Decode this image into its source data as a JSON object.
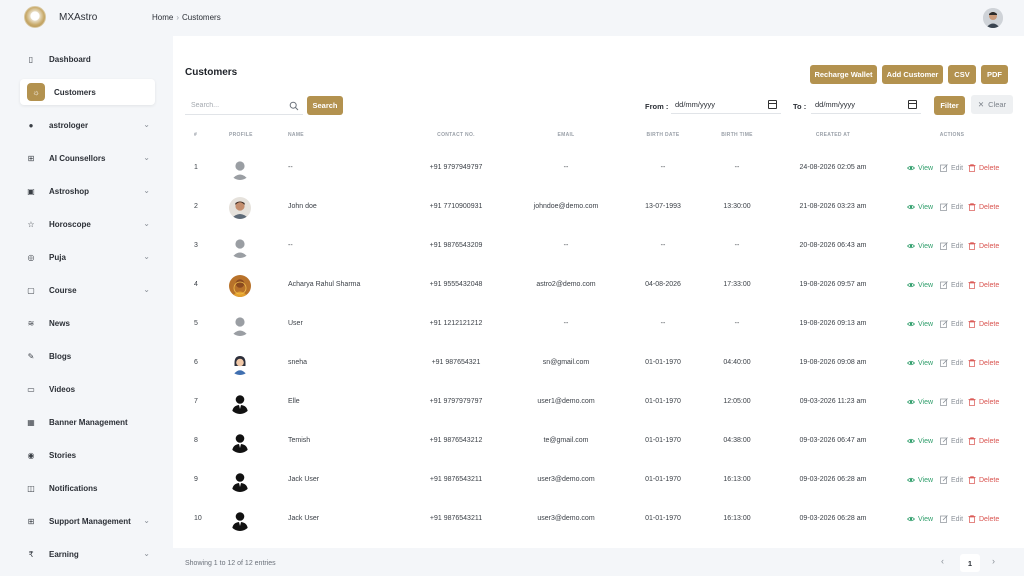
{
  "app": {
    "name": "MXAstro"
  },
  "breadcrumb": {
    "home": "Home",
    "separator": "›",
    "current": "Customers"
  },
  "sidebar": {
    "items": [
      {
        "label": "Dashboard",
        "icon": "▯",
        "chevron": false,
        "active": false
      },
      {
        "label": "Customers",
        "icon": "☼",
        "chevron": false,
        "active": true
      },
      {
        "label": "astrologer",
        "icon": "●",
        "chevron": true,
        "active": false
      },
      {
        "label": "AI Counsellors",
        "icon": "⊞",
        "chevron": true,
        "active": false
      },
      {
        "label": "Astroshop",
        "icon": "▣",
        "chevron": true,
        "active": false
      },
      {
        "label": "Horoscope",
        "icon": "☆",
        "chevron": true,
        "active": false
      },
      {
        "label": "Puja",
        "icon": "◎",
        "chevron": true,
        "active": false
      },
      {
        "label": "Course",
        "icon": "▢",
        "chevron": true,
        "active": false
      },
      {
        "label": "News",
        "icon": "≋",
        "chevron": false,
        "active": false
      },
      {
        "label": "Blogs",
        "icon": "✎",
        "chevron": false,
        "active": false
      },
      {
        "label": "Videos",
        "icon": "▭",
        "chevron": false,
        "active": false
      },
      {
        "label": "Banner Management",
        "icon": "▦",
        "chevron": false,
        "active": false
      },
      {
        "label": "Stories",
        "icon": "◉",
        "chevron": false,
        "active": false
      },
      {
        "label": "Notifications",
        "icon": "◫",
        "chevron": false,
        "active": false
      },
      {
        "label": "Support Management",
        "icon": "⊞",
        "chevron": true,
        "active": false
      },
      {
        "label": "Earning",
        "icon": "₹",
        "chevron": true,
        "active": false
      }
    ],
    "chevron_glyph": "⌄"
  },
  "page": {
    "title": "Customers"
  },
  "toolbar": {
    "recharge_wallet": "Recharge Wallet",
    "add_customer": "Add Customer",
    "csv": "CSV",
    "pdf": "PDF"
  },
  "filters": {
    "search_placeholder": "Search...",
    "search_button": "Search",
    "from_label": "From :",
    "from_value": "dd/mm/yyyy",
    "to_label": "To :",
    "to_value": "dd/mm/yyyy",
    "filter_button": "Filter",
    "clear_button": "Clear"
  },
  "table": {
    "headers": [
      "#",
      "Profile",
      "Name",
      "Contact No.",
      "Email",
      "Birth Date",
      "Birth Time",
      "Created At",
      "Actions"
    ],
    "rows": [
      {
        "num": "1",
        "avatar": "placeholder",
        "name": "--",
        "contact": "+91 9797949797",
        "email": "--",
        "birth_date": "--",
        "birth_time": "--",
        "created_at": "24-08-2026 02:05 am"
      },
      {
        "num": "2",
        "avatar": "photo-man",
        "name": "John doe",
        "contact": "+91 7710900931",
        "email": "johndoe@demo.com",
        "birth_date": "13-07-1993",
        "birth_time": "13:30:00",
        "created_at": "21-08-2026 03:23 am"
      },
      {
        "num": "3",
        "avatar": "placeholder",
        "name": "--",
        "contact": "+91 9876543209",
        "email": "--",
        "birth_date": "--",
        "birth_time": "--",
        "created_at": "20-08-2026 06:43 am"
      },
      {
        "num": "4",
        "avatar": "photo-astro",
        "name": "Acharya Rahul Sharma",
        "contact": "+91 9555432048",
        "email": "astro2@demo.com",
        "birth_date": "04-08-2026",
        "birth_time": "17:33:00",
        "created_at": "19-08-2026 09:57 am"
      },
      {
        "num": "5",
        "avatar": "placeholder",
        "name": "User",
        "contact": "+91 1212121212",
        "email": "--",
        "birth_date": "--",
        "birth_time": "--",
        "created_at": "19-08-2026 09:13 am"
      },
      {
        "num": "6",
        "avatar": "cartoon-woman",
        "name": "sneha",
        "contact": "+91 987654321",
        "email": "sn@gmail.com",
        "birth_date": "01-01-1970",
        "birth_time": "04:40:00",
        "created_at": "19-08-2026 09:08 am"
      },
      {
        "num": "7",
        "avatar": "silhouette",
        "name": "Elle",
        "contact": "+91 9797979797",
        "email": "user1@demo.com",
        "birth_date": "01-01-1970",
        "birth_time": "12:05:00",
        "created_at": "09-03-2026 11:23 am"
      },
      {
        "num": "8",
        "avatar": "silhouette",
        "name": "Temish",
        "contact": "+91 9876543212",
        "email": "te@gmail.com",
        "birth_date": "01-01-1970",
        "birth_time": "04:38:00",
        "created_at": "09-03-2026 06:47 am"
      },
      {
        "num": "9",
        "avatar": "silhouette",
        "name": "Jack User",
        "contact": "+91 9876543211",
        "email": "user3@demo.com",
        "birth_date": "01-01-1970",
        "birth_time": "16:13:00",
        "created_at": "09-03-2026 06:28 am"
      },
      {
        "num": "10",
        "avatar": "silhouette",
        "name": "Jack User",
        "contact": "+91 9876543211",
        "email": "user3@demo.com",
        "birth_date": "01-01-1970",
        "birth_time": "16:13:00",
        "created_at": "09-03-2026 06:28 am"
      }
    ],
    "actions": {
      "view": "View",
      "edit": "Edit",
      "delete": "Delete"
    }
  },
  "footer": {
    "entries_text": "Showing 1 to 12 of 12 entries",
    "prev": "‹",
    "current_page": "1",
    "next": "›"
  },
  "colors": {
    "accent": "#b3924f",
    "view": "#2f9e6b",
    "delete": "#d9534f",
    "background": "#f4f6f9"
  }
}
